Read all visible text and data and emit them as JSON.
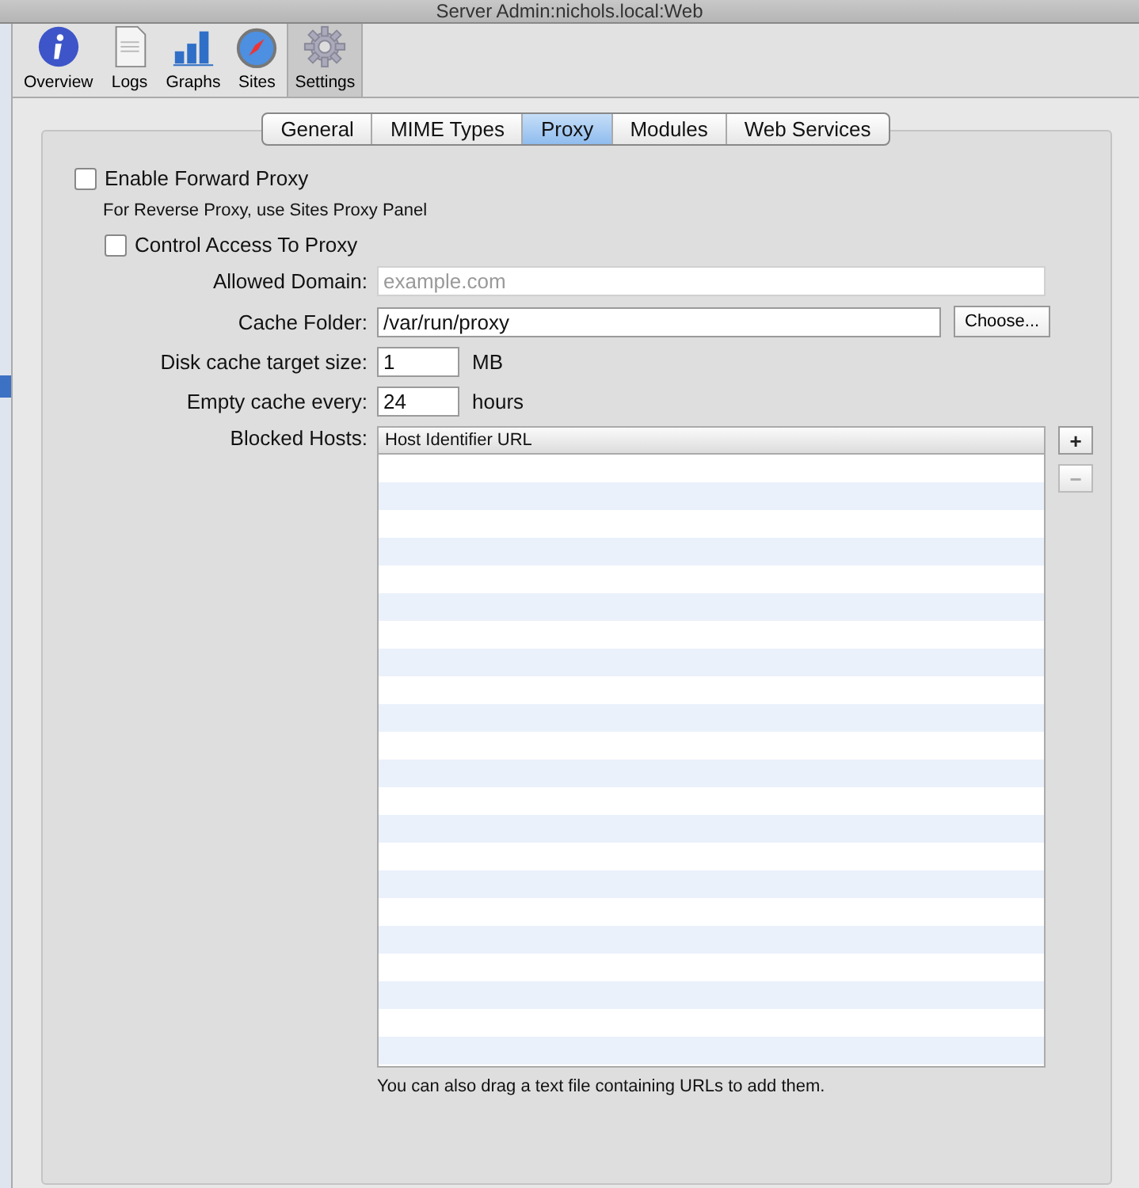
{
  "window": {
    "title": "Server Admin:nichols.local:Web"
  },
  "toolbar": [
    {
      "label": "Overview",
      "kind": "info",
      "selected": false
    },
    {
      "label": "Logs",
      "kind": "logs",
      "selected": false
    },
    {
      "label": "Graphs",
      "kind": "graphs",
      "selected": false
    },
    {
      "label": "Sites",
      "kind": "sites",
      "selected": false
    },
    {
      "label": "Settings",
      "kind": "settings",
      "selected": true
    }
  ],
  "tabs": [
    {
      "label": "General",
      "selected": false
    },
    {
      "label": "MIME Types",
      "selected": false
    },
    {
      "label": "Proxy",
      "selected": true
    },
    {
      "label": "Modules",
      "selected": false
    },
    {
      "label": "Web Services",
      "selected": false
    }
  ],
  "enable_forward_proxy": {
    "label": "Enable Forward Proxy",
    "checked": false
  },
  "reverse_proxy_note": "For Reverse Proxy, use Sites Proxy Panel",
  "control_access": {
    "label": "Control Access To Proxy",
    "checked": false
  },
  "fields": [
    {
      "label": "Allowed Domain:",
      "placeholder": "example.com",
      "kind": "wide",
      "disabled": true
    },
    {
      "label": "Cache Folder:",
      "value": "/var/run/proxy",
      "kind": "folder",
      "button": "Choose..."
    },
    {
      "label": "Disk cache target size:",
      "value": "1",
      "kind": "short",
      "unit": "MB"
    },
    {
      "label": "Empty cache every:",
      "value": "24",
      "kind": "short",
      "unit": "hours"
    }
  ],
  "blocked_hosts": {
    "label": "Blocked Hosts:",
    "column": "Host Identifier URL",
    "add": "+",
    "remove": "−",
    "remove_disabled": true
  },
  "hint": "You can also drag a text file containing URLs to add them."
}
